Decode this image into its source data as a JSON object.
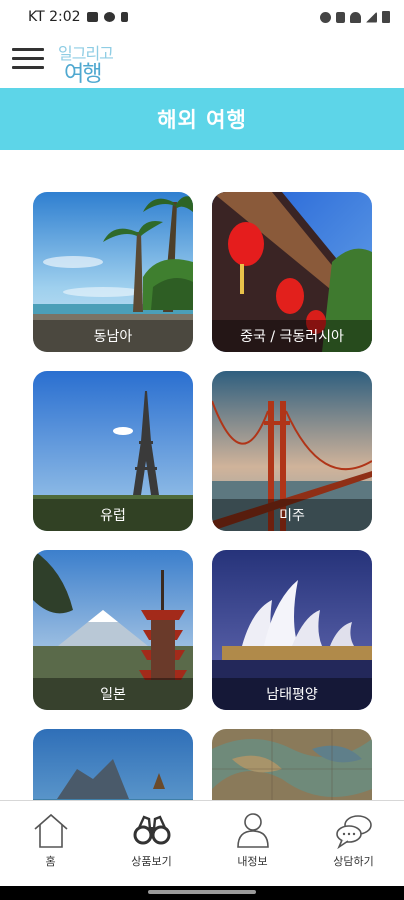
{
  "status_bar": {
    "carrier_time": "KT 2:02",
    "left_icons": [
      "image-icon",
      "message-icon",
      "usb-icon"
    ],
    "right_icons": [
      "alarm-icon",
      "vibrate-icon",
      "wifi-icon",
      "signal-icon",
      "battery-icon"
    ]
  },
  "header": {
    "menu_icon": "hamburger-menu-icon",
    "logo_line1": "일그리고",
    "logo_line2": "여행"
  },
  "page": {
    "title": "해외 여행"
  },
  "destinations": [
    {
      "label": "동남아",
      "scene": "tropical-beach"
    },
    {
      "label": "중국 / 극동러시아",
      "scene": "red-lanterns"
    },
    {
      "label": "유럽",
      "scene": "eiffel-tower"
    },
    {
      "label": "미주",
      "scene": "golden-gate-bridge"
    },
    {
      "label": "일본",
      "scene": "pagoda-fuji"
    },
    {
      "label": "남태평양",
      "scene": "sydney-opera-house"
    },
    {
      "label": "",
      "scene": "mountain-coast"
    },
    {
      "label": "",
      "scene": "old-map"
    }
  ],
  "bottom_nav": {
    "items": [
      {
        "label": "홈",
        "icon": "home-icon"
      },
      {
        "label": "상품보기",
        "icon": "binoculars-icon"
      },
      {
        "label": "내정보",
        "icon": "user-icon"
      },
      {
        "label": "상담하기",
        "icon": "chat-icon"
      }
    ]
  },
  "colors": {
    "banner": "#5dd5e8",
    "logo_light": "#8fcde4",
    "logo_dark": "#4fa8d0"
  }
}
